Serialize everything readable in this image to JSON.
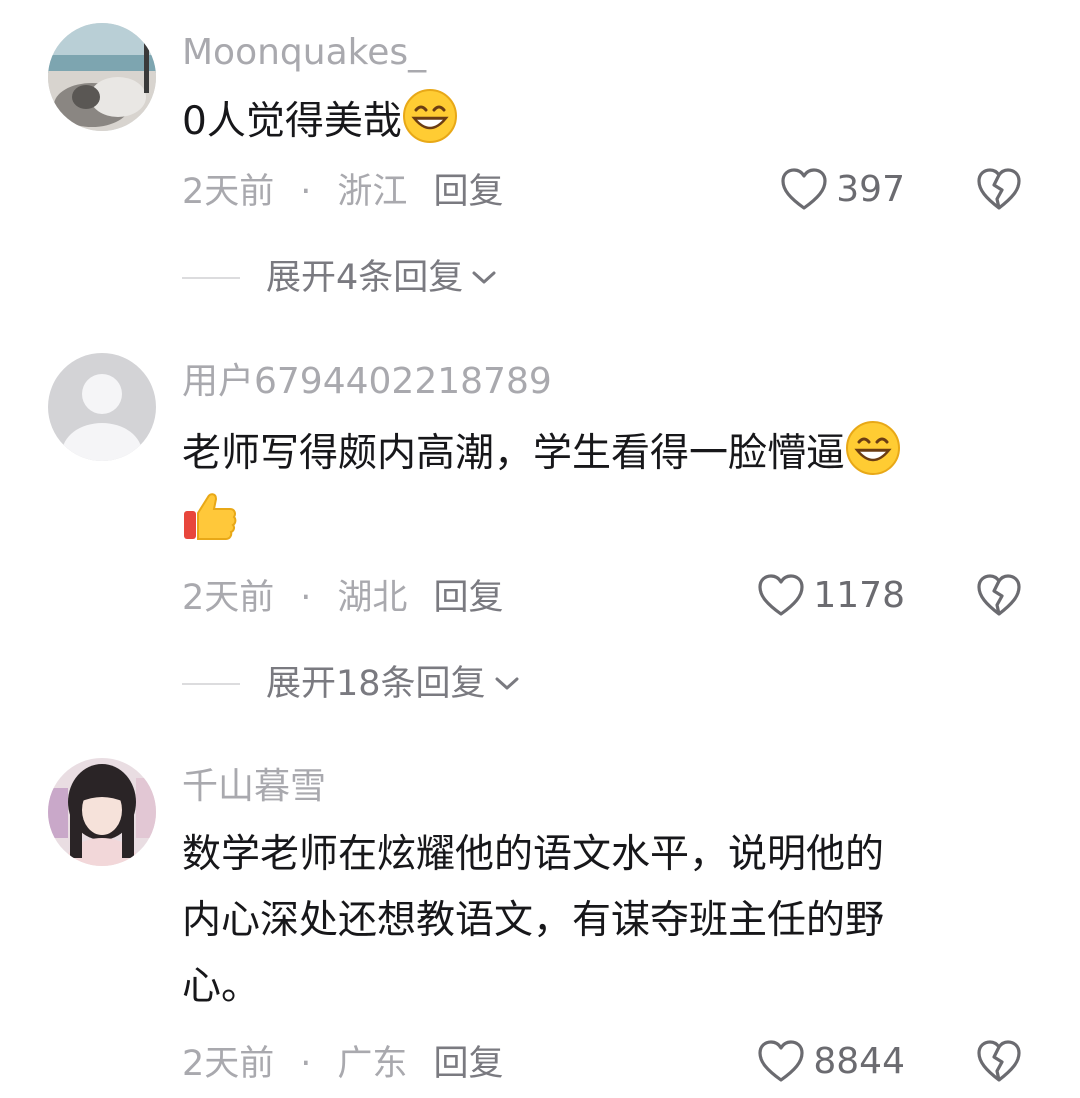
{
  "comments": [
    {
      "username": "Moonquakes_",
      "text": "0人觉得美哉",
      "emoji": "grinning-face-emoji",
      "time": "2天前",
      "separator": "·",
      "location": "浙江",
      "reply_label": "回复",
      "likes": "397",
      "expand_label": "展开4条回复",
      "avatar": "landscape-photo-avatar"
    },
    {
      "username": "用户6794402218789",
      "text": "老师写得颇内高潮，学生看得一脸懵逼",
      "emoji": "grinning-face-emoji",
      "emoji2": "thumbs-up-emoji",
      "time": "2天前",
      "separator": "·",
      "location": "湖北",
      "reply_label": "回复",
      "likes": "1178",
      "expand_label": "展开18条回复",
      "avatar": "default-user-avatar"
    },
    {
      "username": "千山暮雪",
      "text_lines": [
        "数学老师在炫耀他的语文水平，说明他的",
        "内心深处还想教语文，有谋夺班主任的野",
        "心。"
      ],
      "time": "2天前",
      "separator": "·",
      "location": "广东",
      "reply_label": "回复",
      "likes": "8844",
      "avatar": "girl-portrait-avatar"
    }
  ],
  "colors": {
    "username": "#a9a9ae",
    "text": "#17171a",
    "meta": "#a9a9ae",
    "icon": "#6b6b70"
  }
}
